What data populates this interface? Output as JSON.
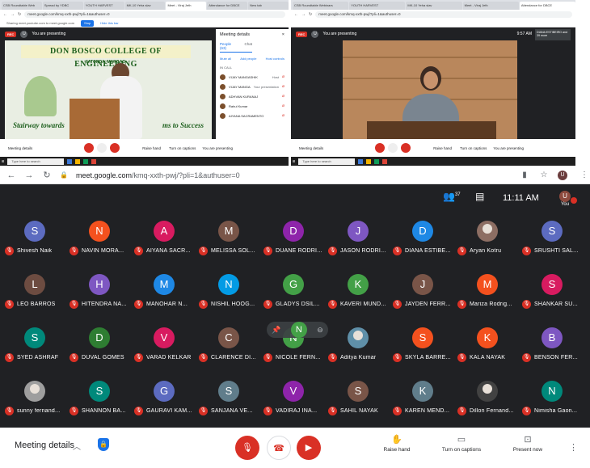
{
  "colors": {
    "accent": "#1a73e8",
    "danger": "#d93025",
    "meet_bg": "#202124"
  },
  "top_left": {
    "tabs": [
      "CSB Roundtable Web",
      "Spread by YDBC",
      "YOUTH HARVEST",
      "MK-10 Yeha slav",
      "Meet - Viraj Jeth",
      "Attendance for DBCE",
      "New tab"
    ],
    "url": "meet.google.com/kmq-xxth-pwj/?pli=1&authuser=0",
    "bookmark_text": "Sharing meet.youtube.com to meet.google.com",
    "bookmark_chip": "Stop",
    "bookmark_hide": "Hide this bar",
    "rec": "REC",
    "presenting": "You are presenting",
    "banner": "DON BOSCO COLLEGE OF ENGINEERING",
    "subtitle": "FATORDA, MARGAO",
    "slogan_left": "Stairway towards",
    "slogan_right": "ms to Success",
    "panel": {
      "title": "Meeting details",
      "close": "×",
      "tab_people": "People (63)",
      "tab_chat": "Chat",
      "action_mute": "Mute all",
      "action_add": "Add people",
      "action_host": "Host controls",
      "section": "IN CALL",
      "rows": [
        {
          "name": "VIJAY MANGASHIK",
          "tag": "Host"
        },
        {
          "name": "VIJAY MANGASHIK",
          "tag": "Your presentation"
        },
        {
          "name": "ADHVAN KURANAJ",
          "tag": ""
        },
        {
          "name": "Rahul Kumar",
          "tag": ""
        },
        {
          "name": "AIYANA SACRAMENTO",
          "tag": ""
        }
      ]
    },
    "controls": {
      "details": "Meeting details",
      "raise": "Raise hand",
      "captions": "Turn on captions",
      "present": "You are presenting"
    },
    "taskbar_search": "Type here to search"
  },
  "top_right": {
    "tabs": [
      "CSB Roundtable Webinars",
      "YOUTH HARVEST",
      "MK-10 Yeha slav",
      "Meet - Viraj Jeth",
      "Attendance for DBCE"
    ],
    "url": "meet.google.com/kmq-xxth-pwj/?pli=1&authuser=0",
    "rec": "REC",
    "presenting": "You are presenting",
    "nameplate": "DIANA ESTIBEIRO and 39 more",
    "time": "9:57 AM",
    "controls": {
      "details": "Meeting details",
      "raise": "Raise hand",
      "captions": "Turn on captions",
      "present": "You are presenting"
    },
    "taskbar_search": "Type here to search"
  },
  "main": {
    "url_host": "meet.google.com",
    "url_path": "/kmq-xxth-pwj/?pli=1&authuser=0",
    "people_count": "37",
    "time": "11:11 AM",
    "you_initial": "U",
    "you_label": "You",
    "hover_icons": [
      "📌",
      "N",
      "⊖"
    ],
    "participants": [
      {
        "initial": "S",
        "name": "Shivesh Naik",
        "color": "#5c6bc0"
      },
      {
        "initial": "N",
        "name": "NAVIN MORA...",
        "color": "#f4511e"
      },
      {
        "initial": "A",
        "name": "AIYANA SACR...",
        "color": "#d81b60"
      },
      {
        "initial": "M",
        "name": "MELISSA SOL...",
        "color": "#795548"
      },
      {
        "initial": "D",
        "name": "DUANE RODRI...",
        "color": "#8e24aa"
      },
      {
        "initial": "J",
        "name": "JASON RODRI...",
        "color": "#7e57c2"
      },
      {
        "initial": "D",
        "name": "DIANA ESTIBE...",
        "color": "#1e88e5"
      },
      {
        "initial": "",
        "name": "Aryan Kotru",
        "color": "#8d6e63",
        "photo": true
      },
      {
        "initial": "S",
        "name": "SRUSHTI SAL...",
        "color": "#5c6bc0"
      },
      {
        "initial": "L",
        "name": "LEO BARROS",
        "color": "#6d4c41"
      },
      {
        "initial": "H",
        "name": "HITENDRA NA...",
        "color": "#7e57c2"
      },
      {
        "initial": "M",
        "name": "MANOHAR N...",
        "color": "#1e88e5"
      },
      {
        "initial": "N",
        "name": "NISHIL HOOG...",
        "color": "#039be5"
      },
      {
        "initial": "G",
        "name": "GLADYS DSIL...",
        "color": "#43a047"
      },
      {
        "initial": "K",
        "name": "KAVERI MUND...",
        "color": "#43a047"
      },
      {
        "initial": "J",
        "name": "JAYDEN FERR...",
        "color": "#795548"
      },
      {
        "initial": "M",
        "name": "Mariza Rodrig...",
        "color": "#f4511e"
      },
      {
        "initial": "S",
        "name": "SHANKAR SU...",
        "color": "#d81b60"
      },
      {
        "initial": "S",
        "name": "SYED ASHRAF",
        "color": "#00897b"
      },
      {
        "initial": "D",
        "name": "DUVAL GOMES",
        "color": "#2e7d32"
      },
      {
        "initial": "V",
        "name": "VARAD KELKAR",
        "color": "#d81b60"
      },
      {
        "initial": "C",
        "name": "CLARENCE DI...",
        "color": "#795548"
      },
      {
        "initial": "N",
        "name": "NICOLE FERN...",
        "color": "#43a047"
      },
      {
        "initial": "",
        "name": "Aditya Kumar",
        "color": "#5f8fa8",
        "photo": true
      },
      {
        "initial": "S",
        "name": "SKYLA BARRE...",
        "color": "#f4511e"
      },
      {
        "initial": "K",
        "name": "KALA NAYAK",
        "color": "#f4511e"
      },
      {
        "initial": "B",
        "name": "BENSON FER...",
        "color": "#7e57c2"
      },
      {
        "initial": "",
        "name": "sunny fernand...",
        "color": "#9e9e9e",
        "photo": true
      },
      {
        "initial": "S",
        "name": "SHANNON BA...",
        "color": "#00897b"
      },
      {
        "initial": "G",
        "name": "GAURAVI KAM...",
        "color": "#5c6bc0"
      },
      {
        "initial": "S",
        "name": "SANJANA VE...",
        "color": "#607d8b"
      },
      {
        "initial": "V",
        "name": "VADIRAJ INA...",
        "color": "#8e24aa"
      },
      {
        "initial": "S",
        "name": "SAHIL NAYAK",
        "color": "#795548"
      },
      {
        "initial": "K",
        "name": "KAREN MEND...",
        "color": "#607d8b"
      },
      {
        "initial": "",
        "name": "Dillon Fernand...",
        "color": "#424242",
        "photo": true
      },
      {
        "initial": "N",
        "name": "Nimisha Gaon...",
        "color": "#00897b"
      }
    ],
    "bottom": {
      "details": "Meeting details",
      "raise": "Raise hand",
      "captions": "Turn on captions",
      "present": "Present now"
    }
  }
}
